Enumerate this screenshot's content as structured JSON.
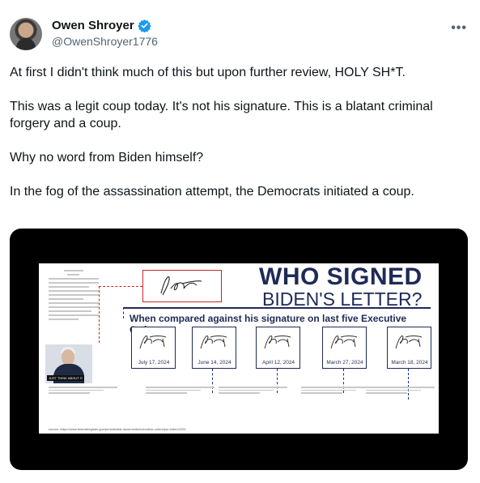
{
  "author": {
    "name": "Owen Shroyer",
    "handle": "@OwenShroyer1776",
    "verified_color": "#1d9bf0"
  },
  "more_icon": "•••",
  "tweet": {
    "p1": "At first I didn't think much of this but upon further review, HOLY SH*T.",
    "p2": "This was a legit coup today. It's not his signature. This is a blatant criminal forgery and a coup.",
    "p3": "Why no word from Biden himself?",
    "p4": "In the fog of the assassination attempt, the Democrats initiated a coup."
  },
  "image": {
    "title_line1": "WHO SIGNED",
    "title_line2": "BIDEN'S LETTER?",
    "compare_text": "When compared against his signature on last five Executive Orders:",
    "photo_caption": "JUST THINK ABOUT IT",
    "orders": [
      {
        "date": "July 17, 2024"
      },
      {
        "date": "June 14, 2024"
      },
      {
        "date": "April 12, 2024"
      },
      {
        "date": "March 27, 2024"
      },
      {
        "date": "March 18, 2024"
      }
    ],
    "source": "source: https://www.federalregister.gov/presidential-documents/executive-orders/joe-biden/2024"
  }
}
